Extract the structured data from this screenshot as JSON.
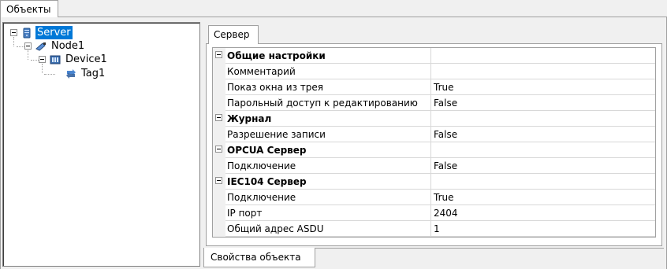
{
  "window_tab": {
    "label": "Объекты"
  },
  "tree": {
    "nodes": [
      {
        "label": "Server",
        "icon": "server-icon",
        "selected": true
      },
      {
        "label": "Node1",
        "icon": "node-icon",
        "selected": false
      },
      {
        "label": "Device1",
        "icon": "device-icon",
        "selected": false
      },
      {
        "label": "Tag1",
        "icon": "tag-icon",
        "selected": false
      }
    ]
  },
  "properties": {
    "tab_label": "Сервер",
    "rows": [
      {
        "name": "Общие настройки",
        "value": "",
        "category": true
      },
      {
        "name": "Комментарий",
        "value": "",
        "category": false
      },
      {
        "name": "Показ окна из трея",
        "value": "True",
        "category": false
      },
      {
        "name": "Парольный доступ к редактированию",
        "value": "False",
        "category": false
      },
      {
        "name": "Журнал",
        "value": "",
        "category": true
      },
      {
        "name": "Разрешение записи",
        "value": "False",
        "category": false
      },
      {
        "name": "OPCUA Сервер",
        "value": "",
        "category": true
      },
      {
        "name": "Подключение",
        "value": "False",
        "category": false
      },
      {
        "name": "IEC104 Сервер",
        "value": "",
        "category": true
      },
      {
        "name": "Подключение",
        "value": "True",
        "category": false
      },
      {
        "name": "IP порт",
        "value": "2404",
        "category": false
      },
      {
        "name": "Общий адрес ASDU",
        "value": "1",
        "category": false
      }
    ]
  },
  "bottom_tab": {
    "label": "Свойства объекта"
  },
  "colors": {
    "selection": "#0078d7",
    "border": "#a0a0a0",
    "panel": "#f0f0f0"
  }
}
